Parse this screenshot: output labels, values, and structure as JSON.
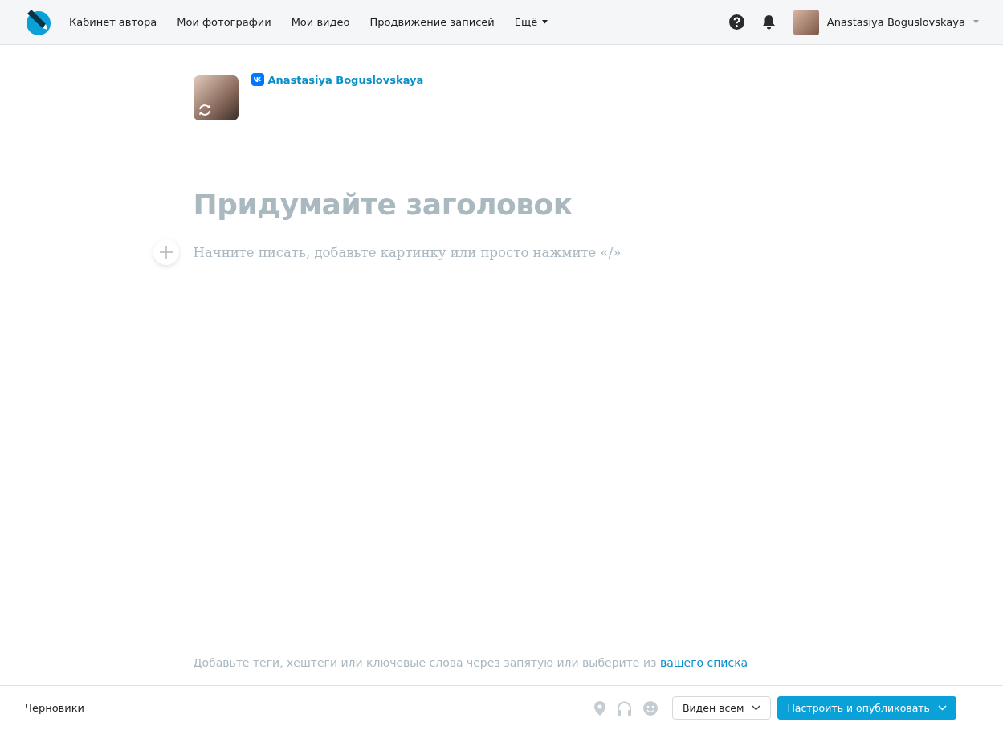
{
  "header": {
    "nav": [
      {
        "label": "Кабинет автора",
        "kind": "link"
      },
      {
        "label": "Мои фотографии",
        "kind": "link"
      },
      {
        "label": "Мои видео",
        "kind": "link"
      },
      {
        "label": "Продвижение записей",
        "kind": "link"
      },
      {
        "label": "Ещё",
        "kind": "menu"
      }
    ],
    "user_name": "Anastasiya Boguslovskaya"
  },
  "author": {
    "name": "Anastasiya Boguslovskaya"
  },
  "editor": {
    "title_placeholder": "Придумайте заголовок",
    "body_placeholder": "Начните писать, добавьте картинку или просто нажмите «/»"
  },
  "tags": {
    "hint": "Добавьте теги, хештеги или ключевые слова через запятую или выберите из",
    "link": "вашего списка"
  },
  "footer": {
    "drafts": "Черновики",
    "visibility": "Виден всем",
    "publish": "Настроить и опубликовать"
  }
}
